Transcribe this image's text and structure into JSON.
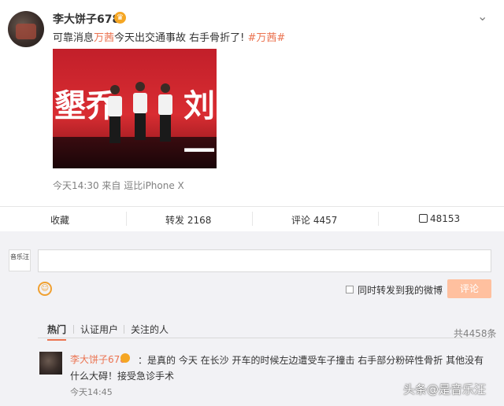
{
  "post": {
    "username": "李大饼子678",
    "content_prefix": "可靠消息",
    "content_highlight": "万茜",
    "content_rest": "今天出交通事故 右手骨折了!",
    "hashtag": "#万茜#",
    "photo_text_left": "墾乔",
    "photo_text_right": "刘一",
    "timestamp": "今天14:30",
    "source": "来自 逗比iPhone X"
  },
  "actions": {
    "favorite": "收藏",
    "repost": "转发 2168",
    "comment": "评论 4457",
    "like": "48153"
  },
  "comment_box": {
    "avatar_text": "音乐汪",
    "repost_label": "同时转发到我的微博",
    "submit": "评论"
  },
  "tabs": {
    "hot": "热门",
    "verified": "认证用户",
    "following": "关注的人",
    "total": "共4458条"
  },
  "comment": {
    "user": "李大饼子678",
    "text": "：是真的 今天 在长沙 开车的时候左边遭受车子撞击 右手部分粉碎性骨折 其他没有什么大碍！接受急诊手术",
    "time": "今天14:45"
  },
  "watermark": "头条@是音乐汪",
  "icons": [
    "chevron-down-icon",
    "vip-crown-icon",
    "like-thumb-icon",
    "smiley-icon"
  ],
  "colors": {
    "accent": "#eb7350",
    "submit_disabled": "#ffc09f",
    "panel_bg": "#f2f2f5"
  }
}
